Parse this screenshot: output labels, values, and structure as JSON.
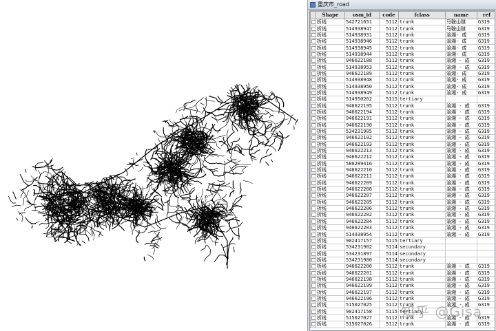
{
  "window": {
    "title": "重庆市_road"
  },
  "table": {
    "columns": [
      "Shape",
      "osm_id",
      "code",
      "fclass",
      "name",
      "ref"
    ],
    "rows": [
      [
        "折线",
        "542721651",
        "5112",
        "trunk",
        "马鞍山隧",
        "G319"
      ],
      [
        "折线",
        "514938947",
        "5112",
        "trunk",
        "马鞍山隧",
        "G319"
      ],
      [
        "折线",
        "514938931",
        "5112",
        "trunk",
        "渝湘- 成",
        "G319"
      ],
      [
        "折线",
        "514938946",
        "5112",
        "trunk",
        "渝湘- 成",
        "G319"
      ],
      [
        "折线",
        "514938945",
        "5112",
        "trunk",
        "渝湘- 成",
        "G319"
      ],
      [
        "折线",
        "514938944",
        "5112",
        "trunk",
        "渝湘- 成",
        "G319"
      ],
      [
        "折线",
        "946622188",
        "5112",
        "trunk",
        "渝湘 - 成",
        "G319"
      ],
      [
        "折线",
        "514938953",
        "5112",
        "trunk",
        "渝湘 - 成",
        "G319"
      ],
      [
        "折线",
        "946622189",
        "5112",
        "trunk",
        "渝湘- 成",
        "G319"
      ],
      [
        "折线",
        "514938948",
        "5112",
        "trunk",
        "渝湘- 成",
        "G319"
      ],
      [
        "折线",
        "514938950",
        "5112",
        "trunk",
        "渝湘- 成",
        "G319"
      ],
      [
        "折线",
        "514938949",
        "5112",
        "trunk",
        "渝湘- 成",
        "G319"
      ],
      [
        "折线",
        "514950262",
        "5115",
        "tertiary",
        "",
        ""
      ],
      [
        "折线",
        "946622195",
        "5112",
        "trunk",
        "渝湘 - 成",
        "G319"
      ],
      [
        "折线",
        "946622194",
        "5112",
        "trunk",
        "渝湘 - 成",
        "G319"
      ],
      [
        "折线",
        "946622191",
        "5112",
        "trunk",
        "渝湘 - 成",
        "G319"
      ],
      [
        "折线",
        "946622190",
        "5112",
        "trunk",
        "渝湘 - 成",
        "G319"
      ],
      [
        "折线",
        "534231905",
        "5112",
        "trunk",
        "渝湘 - 成",
        "G319"
      ],
      [
        "折线",
        "946622192",
        "5112",
        "trunk",
        "渝湘 - 成",
        "G319"
      ],
      [
        "折线",
        "946622193",
        "5112",
        "trunk",
        "渝湘 - 成",
        "G319"
      ],
      [
        "折线",
        "946622213",
        "5112",
        "trunk",
        "渝湘 - 成",
        "G319"
      ],
      [
        "折线",
        "946622212",
        "5112",
        "trunk",
        "渝湘 - 成",
        "G319"
      ],
      [
        "折线",
        "580289416",
        "5112",
        "trunk",
        "渝湘 - 成",
        "G319"
      ],
      [
        "折线",
        "946622210",
        "5112",
        "trunk",
        "渝湘 - 成",
        "G319"
      ],
      [
        "折线",
        "946622211",
        "5112",
        "trunk",
        "渝湘 - 成",
        "G319"
      ],
      [
        "折线",
        "946622209",
        "5112",
        "trunk",
        "渝湘 - 成",
        "G319"
      ],
      [
        "折线",
        "946622208",
        "5112",
        "trunk",
        "渝湘 - 成",
        "G319"
      ],
      [
        "折线",
        "946622207",
        "5112",
        "trunk",
        "渝湘 - 成",
        "G319"
      ],
      [
        "折线",
        "946622205",
        "5112",
        "trunk",
        "渝湘 - 成",
        "G319"
      ],
      [
        "折线",
        "946622206",
        "5112",
        "trunk",
        "渝湘 - 成",
        "G319"
      ],
      [
        "折线",
        "946622202",
        "5112",
        "trunk",
        "渝湘 - 成",
        "G319"
      ],
      [
        "折线",
        "946622204",
        "5112",
        "trunk",
        "渝湘 - 成",
        "G319"
      ],
      [
        "折线",
        "946622203",
        "5112",
        "trunk",
        "渝湘 - 成",
        "G319"
      ],
      [
        "折线",
        "514938954",
        "5112",
        "trunk",
        "渝湘 - 成",
        "G319"
      ],
      [
        "折线",
        "902417157",
        "5115",
        "tertiary",
        "",
        ""
      ],
      [
        "折线",
        "534231902",
        "5114",
        "secondary",
        "",
        ""
      ],
      [
        "折线",
        "534231897",
        "5114",
        "secondary",
        "",
        ""
      ],
      [
        "折线",
        "534231900",
        "5114",
        "secondary",
        "",
        ""
      ],
      [
        "折线",
        "946622200",
        "5112",
        "trunk",
        "渝湘 - 成",
        "G319"
      ],
      [
        "折线",
        "946622201",
        "5112",
        "trunk",
        "渝湘 - 成",
        "G319"
      ],
      [
        "折线",
        "946622198",
        "5112",
        "trunk",
        "渝湘 - 成",
        "G319"
      ],
      [
        "折线",
        "946622199",
        "5112",
        "trunk",
        "渝湘 - 成",
        "G319"
      ],
      [
        "折线",
        "946622197",
        "5112",
        "trunk",
        "渝湘 - 成",
        "G319"
      ],
      [
        "折线",
        "946622196",
        "5112",
        "trunk",
        "渝湘 - 成",
        "G319"
      ],
      [
        "折线",
        "515027025",
        "5112",
        "trunk",
        "渝湘 - 成",
        "G319"
      ],
      [
        "折线",
        "902417158",
        "5115",
        "tertiary",
        "",
        ""
      ],
      [
        "折线",
        "515027027",
        "5112",
        "trunk",
        "渝湘 - 成",
        "G319"
      ],
      [
        "折线",
        "515027026",
        "5112",
        "trunk",
        "渝湘 - 成",
        "G319"
      ]
    ]
  },
  "watermark": "知乎 @Gisa",
  "colors": {
    "road": "#000000",
    "background": "#ffffff",
    "window_frame": "#d9dde3"
  }
}
